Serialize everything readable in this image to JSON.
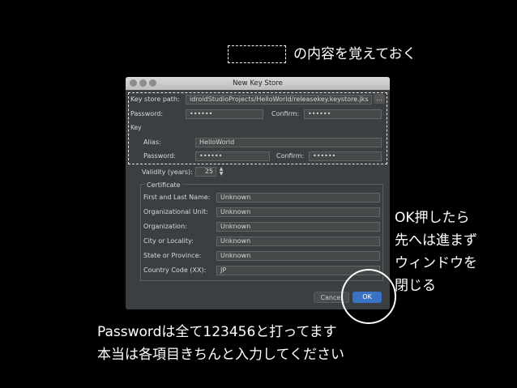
{
  "annotations": {
    "legend_text": "の内容を覚えておく",
    "side_note": [
      "OK押したら",
      "先へは進まず",
      "ウィンドウを",
      "閉じる"
    ],
    "bottom_note": [
      "Passwordは全て123456と打ってます",
      "本当は各項目きちんと入力してください"
    ]
  },
  "dialog": {
    "title": "New Key Store",
    "key_store_path_label": "Key store path:",
    "key_store_path_value": "idroidStudioProjects/HelloWorld/releasekey.keystore.jks",
    "browse_label": "...",
    "password_label": "Password:",
    "password_value": "••••••",
    "confirm_label": "Confirm:",
    "confirm_value": "••••••",
    "key_section_label": "Key",
    "alias_label": "Alias:",
    "alias_value": "HelloWorld",
    "key_password_label": "Password:",
    "key_password_value": "••••••",
    "key_confirm_label": "Confirm:",
    "key_confirm_value": "••••••",
    "validity_label": "Validity (years):",
    "validity_value": "25",
    "certificate_label": "Certificate",
    "cert_fields": [
      {
        "label": "First and Last Name:",
        "value": "Unknown"
      },
      {
        "label": "Organizational Unit:",
        "value": "Unknown"
      },
      {
        "label": "Organization:",
        "value": "Unknown"
      },
      {
        "label": "City or Locality:",
        "value": "Unknown"
      },
      {
        "label": "State or Province:",
        "value": "Unknown"
      },
      {
        "label": "Country Code (XX):",
        "value": "JP"
      }
    ],
    "cancel_label": "Cancel",
    "ok_label": "OK",
    "colors": {
      "ok_button": "#3a73c6",
      "window_bg": "#3c3f41"
    }
  }
}
